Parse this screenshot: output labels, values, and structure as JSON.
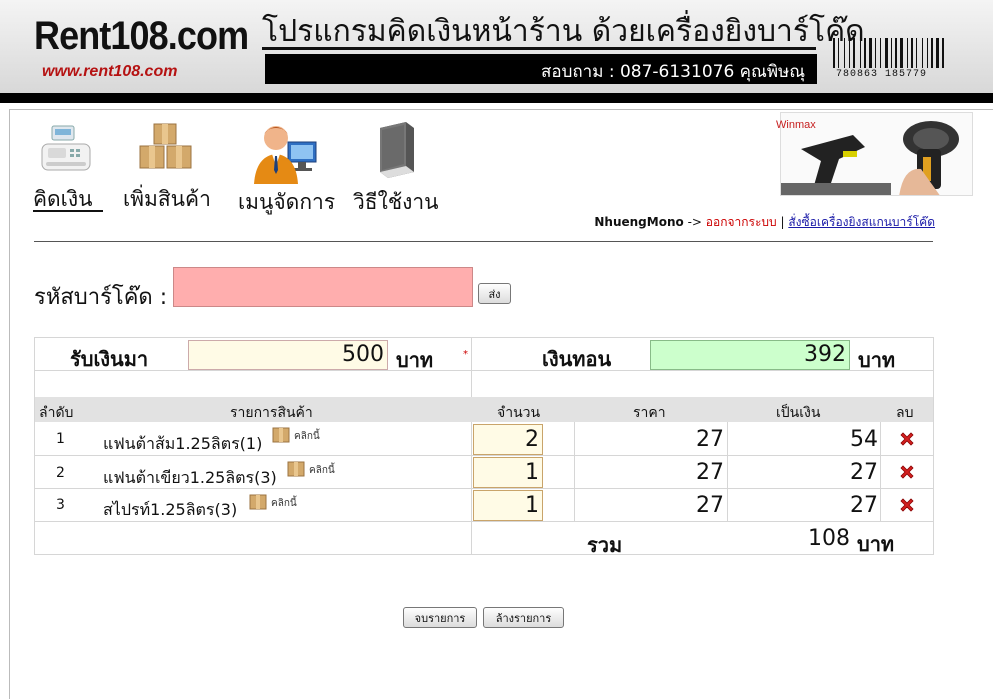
{
  "header": {
    "logo": "Rent108.com",
    "logo_url": "www.rent108.com",
    "title": "โปรแกรมคิดเงินหน้าร้าน ด้วยเครื่องยิงบาร์โค๊ด",
    "contact": "สอบถาม : 087-6131076 คุณพิษณุ",
    "barcode_number": "780863 185779"
  },
  "menu": [
    {
      "label": "คิดเงิน",
      "icon": "cash-register-icon"
    },
    {
      "label": "เพิ่มสินค้า",
      "icon": "boxes-icon"
    },
    {
      "label": "เมนูจัดการ",
      "icon": "admin-computer-icon"
    },
    {
      "label": "วิธีใช้งาน",
      "icon": "book-icon"
    }
  ],
  "ad": {
    "brand": "Winmax"
  },
  "user": {
    "name": "NhuengMono",
    "arrow": "->",
    "logout": "ออกจากระบบ",
    "separator": "|",
    "order_link": "สั่งซื้อเครื่องยิงสแกนบาร์โค๊ด"
  },
  "barcode_form": {
    "label": "รหัสบาร์โค๊ด :",
    "value": "",
    "submit": "ส่ง"
  },
  "payment": {
    "received_label": "รับเงินมา",
    "received_value": "500",
    "received_unit": "บาท",
    "required_mark": "*",
    "change_label": "เงินทอน",
    "change_value": "392",
    "change_unit": "บาท"
  },
  "table": {
    "headers": {
      "index": "ลำดับ",
      "item": "รายการสินค้า",
      "qty": "จำนวน",
      "price": "ราคา",
      "amount": "เป็นเงิน",
      "delete": "ลบ"
    },
    "click_label": "คลิกนี้",
    "rows": [
      {
        "index": "1",
        "name": "แฟนต้าส้ม1.25ลิตร(1)",
        "qty": "2",
        "price": "27",
        "amount": "54"
      },
      {
        "index": "2",
        "name": "แฟนต้าเขียว1.25ลิตร(3)",
        "qty": "1",
        "price": "27",
        "amount": "27"
      },
      {
        "index": "3",
        "name": "สไปรท์1.25ลิตร(3)",
        "qty": "1",
        "price": "27",
        "amount": "27"
      }
    ],
    "total_label": "รวม",
    "total_value": "108",
    "total_unit": "บาท"
  },
  "actions": {
    "finish": "จบรายการ",
    "clear": "ล้างรายการ"
  }
}
